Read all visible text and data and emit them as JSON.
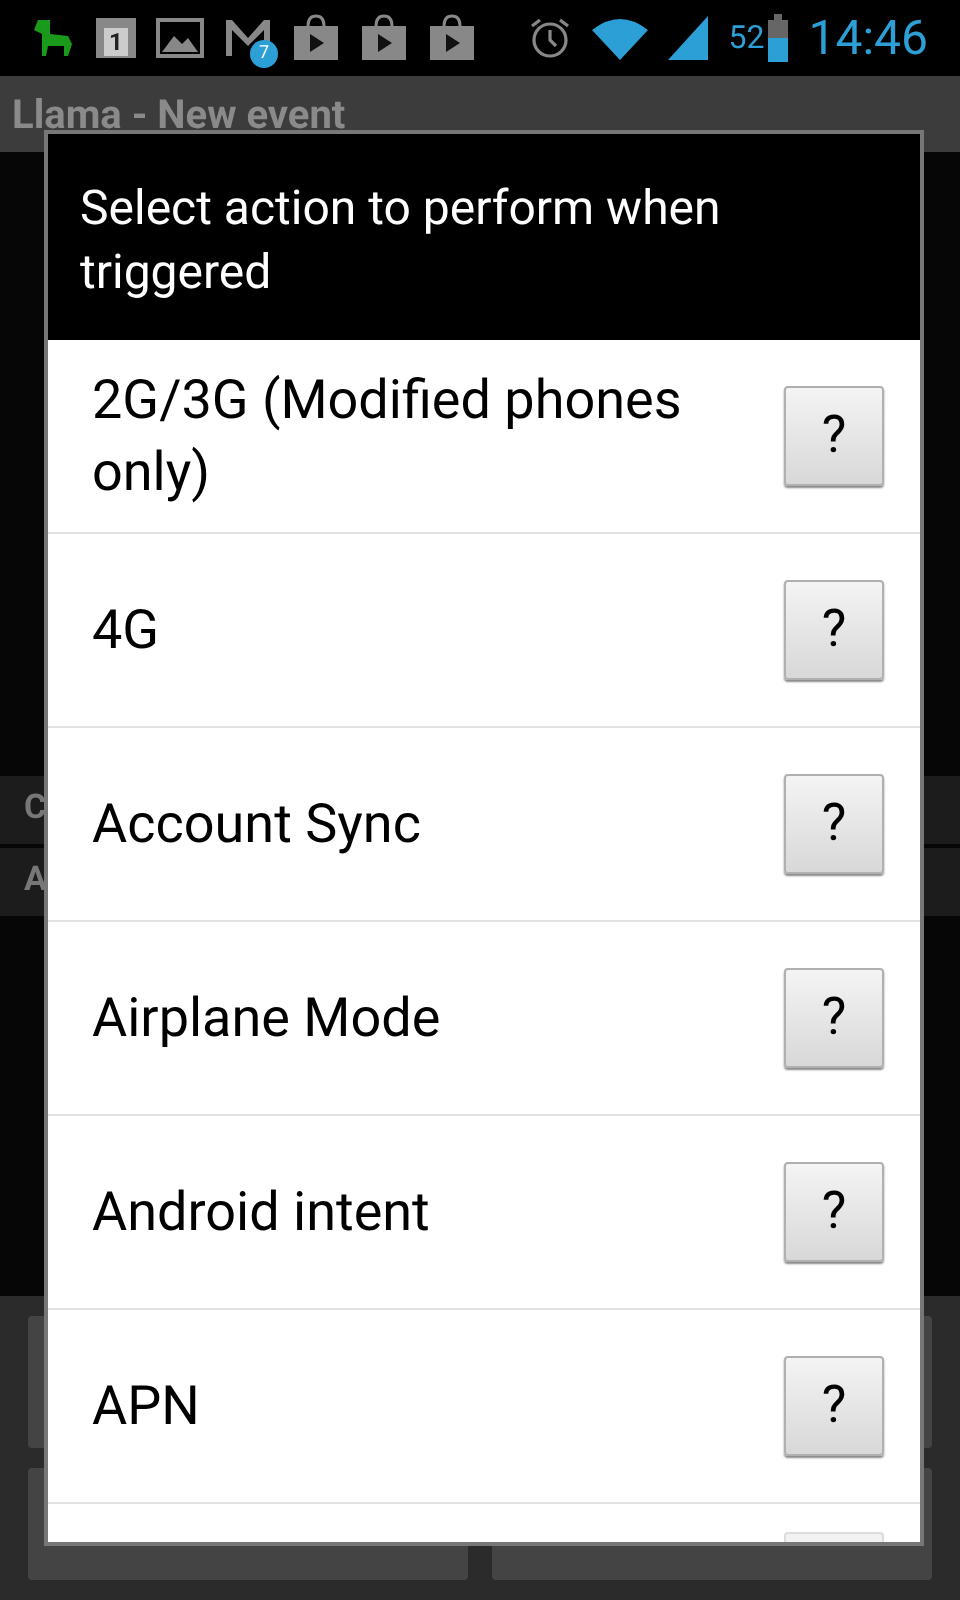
{
  "status_bar": {
    "notification_count": "7",
    "calendar_day": "1",
    "battery": "52",
    "time": "14:46"
  },
  "window": {
    "title": "Llama - New event"
  },
  "background_sections": [
    "C",
    "A"
  ],
  "dialog": {
    "title": "Select action to perform when triggered",
    "items": [
      {
        "label": "2G/3G (Modified phones only)",
        "help": "?"
      },
      {
        "label": "4G",
        "help": "?"
      },
      {
        "label": "Account Sync",
        "help": "?"
      },
      {
        "label": "Airplane Mode",
        "help": "?"
      },
      {
        "label": "Android intent",
        "help": "?"
      },
      {
        "label": "APN",
        "help": "?"
      }
    ]
  }
}
